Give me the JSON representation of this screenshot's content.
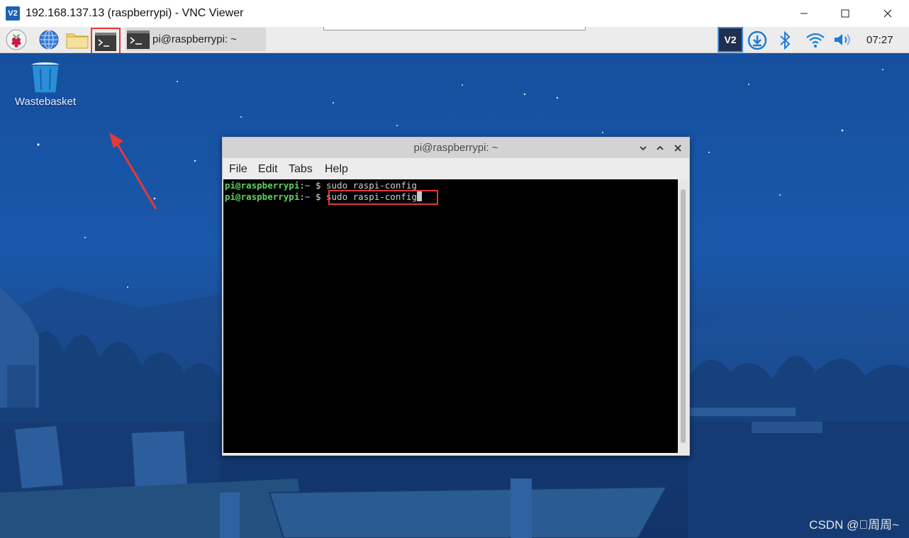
{
  "window": {
    "logo_text": "V2",
    "title": "192.168.137.13 (raspberrypi) - VNC Viewer",
    "controls": {
      "minimize": "—",
      "maximize": "☐",
      "close": "✕"
    }
  },
  "taskbar": {
    "icons": [
      "raspberry-icon",
      "web-browser-icon",
      "file-manager-icon",
      "terminal-icon"
    ],
    "task_window_label": "pi@raspberrypi: ~",
    "tray_vnc_label": "V2",
    "clock": "07:27"
  },
  "desktop": {
    "wastebasket_label": "Wastebasket",
    "watermark": "CSDN @\u0000周周~"
  },
  "terminal": {
    "title": "pi@raspberrypi: ~",
    "menu": [
      "File",
      "Edit",
      "Tabs",
      "Help"
    ],
    "lines": [
      {
        "user": "pi@raspberrypi",
        "colon": ":",
        "path": "~",
        "sign": " $ ",
        "command": "sudo raspi-config"
      },
      {
        "user": "pi@raspberrypi",
        "colon": ":",
        "path": "~",
        "sign": " $ ",
        "command": "sudo raspi-config"
      }
    ]
  },
  "colors": {
    "highlight": "#e53935",
    "prompt_user": "#5fd35f",
    "prompt_path": "#6f8cff",
    "desktop_blue": "#1a58ab"
  }
}
